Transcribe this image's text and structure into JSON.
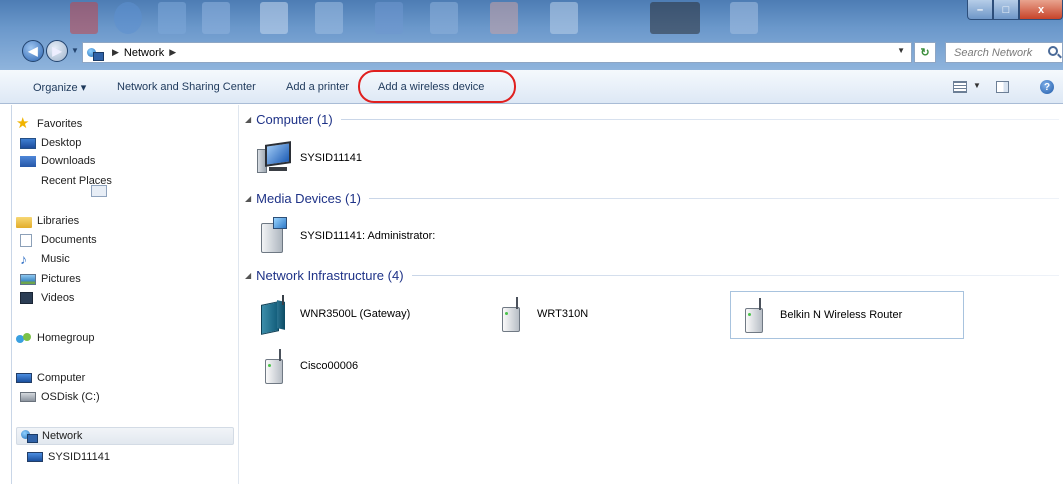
{
  "window": {
    "breadcrumb": [
      "Network"
    ],
    "search_placeholder": "Search Network",
    "controls": {
      "minimize": "–",
      "maximize": "□",
      "close": "x"
    }
  },
  "toolbar": {
    "organize": "Organize ▾",
    "network_sharing": "Network and Sharing Center",
    "add_printer": "Add a printer",
    "add_wireless": "Add a wireless device",
    "help": "?"
  },
  "sidebar": {
    "favorites": {
      "label": "Favorites",
      "items": [
        "Desktop",
        "Downloads",
        "Recent Places"
      ]
    },
    "libraries": {
      "label": "Libraries",
      "items": [
        "Documents",
        "Music",
        "Pictures",
        "Videos"
      ]
    },
    "homegroup": "Homegroup",
    "computer": {
      "label": "Computer",
      "items": [
        "OSDisk (C:)"
      ]
    },
    "network": {
      "label": "Network",
      "items": [
        "SYSID11141"
      ]
    }
  },
  "groups": [
    {
      "title": "Computer (1)",
      "items": [
        "SYSID11141"
      ]
    },
    {
      "title": "Media Devices (1)",
      "items": [
        "SYSID11141: Administrator:"
      ]
    },
    {
      "title": "Network Infrastructure (4)",
      "items": [
        "WNR3500L (Gateway)",
        "WRT310N",
        "Belkin N Wireless Router",
        "Cisco00006"
      ]
    }
  ],
  "colors": {
    "highlight_ring": "#e0201f",
    "group_title": "#1e3287",
    "titlebar": "#6b98cb"
  },
  "icons": {
    "back": "back-arrow-icon",
    "forward": "forward-arrow-icon",
    "refresh": "refresh-icon",
    "search": "search-icon",
    "help": "help-icon"
  }
}
